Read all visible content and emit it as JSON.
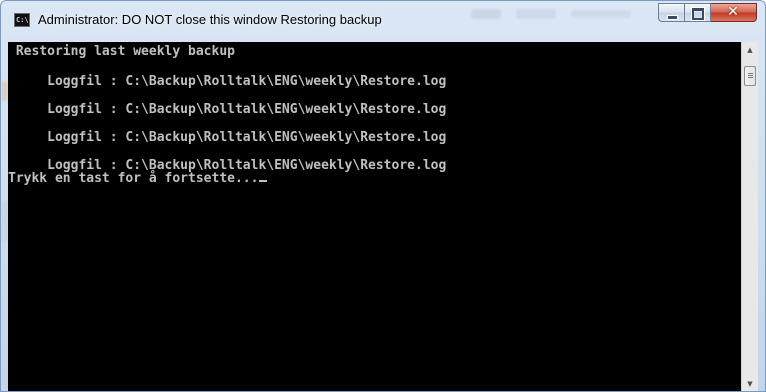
{
  "window": {
    "title": "Administrator:  DO NOT close this window Restoring backup",
    "app_icon_text": "C:\\",
    "buttons": {
      "minimize": "minimize",
      "maximize": "maximize",
      "close": "✕"
    }
  },
  "console": {
    "lines": [
      " Restoring last weekly backup",
      "     Loggfil : C:\\Backup\\Rolltalk\\ENG\\weekly\\Restore.log",
      "     Loggfil : C:\\Backup\\Rolltalk\\ENG\\weekly\\Restore.log",
      "     Loggfil : C:\\Backup\\Rolltalk\\ENG\\weekly\\Restore.log",
      "     Loggfil : C:\\Backup\\Rolltalk\\ENG\\weekly\\Restore.log",
      "Trykk en tast for å fortsette..."
    ],
    "text_color": "#c0c0c0",
    "background": "#000000"
  },
  "scrollbar": {
    "up_arrow": "▲",
    "down_arrow": "▼"
  },
  "colors": {
    "close_button": "#c13a23",
    "frame": "#c4d5ea"
  }
}
